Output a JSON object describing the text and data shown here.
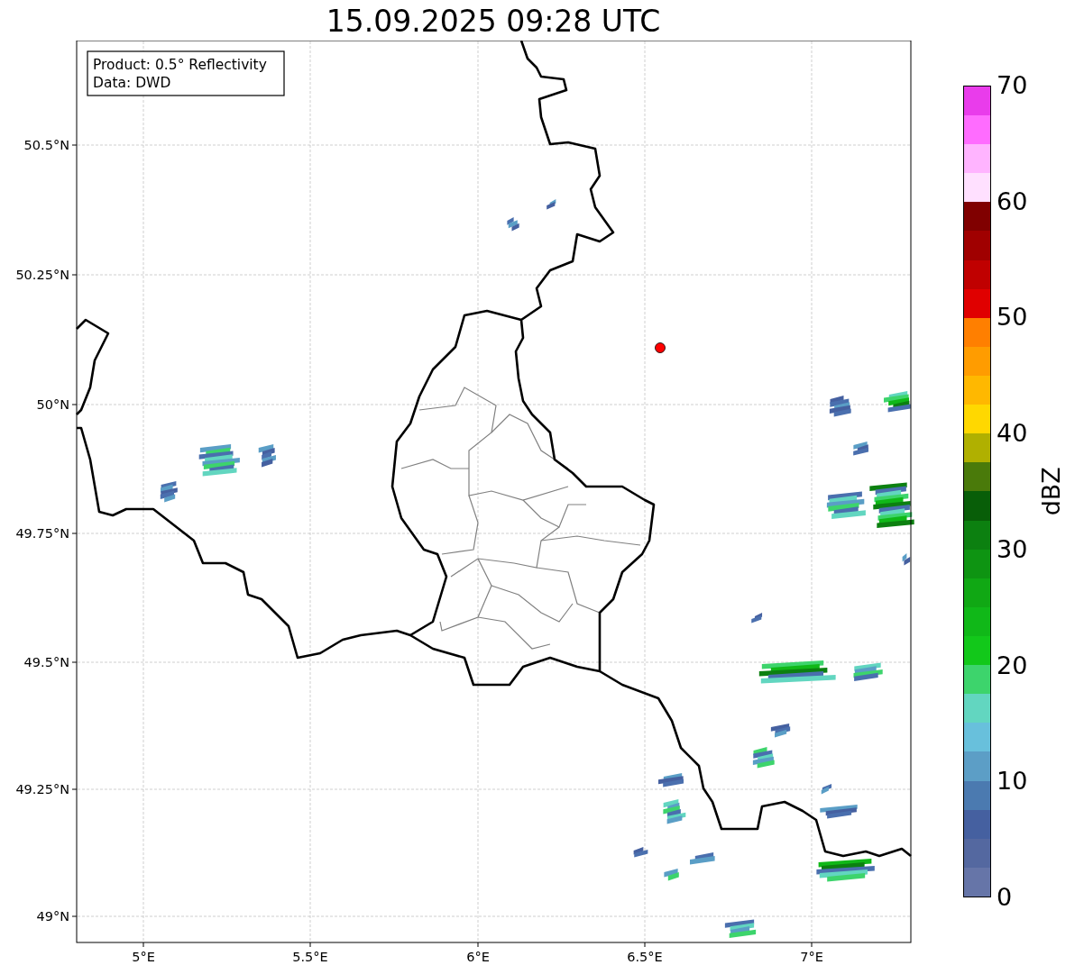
{
  "title": "15.09.2025 09:28 UTC",
  "info_box": [
    "Product: 0.5° Reflectivity",
    "Data: DWD"
  ],
  "map": {
    "x_ticks": [
      "5°E",
      "5.5°E",
      "6°E",
      "6.5°E",
      "7°E"
    ],
    "y_ticks": [
      "50.5°N",
      "50.25°N",
      "50°N",
      "49.75°N",
      "49.5°N",
      "49.25°N",
      "49°N"
    ]
  },
  "colorbar": {
    "label": "dBZ",
    "ticks": [
      "70",
      "60",
      "50",
      "40",
      "30",
      "20",
      "10",
      "0"
    ],
    "bins": [
      {
        "color": "#6675a8"
      },
      {
        "color": "#5468a0"
      },
      {
        "color": "#4560a0"
      },
      {
        "color": "#4b7ab0"
      },
      {
        "color": "#5c9ec6"
      },
      {
        "color": "#68c0dc"
      },
      {
        "color": "#62d6c0"
      },
      {
        "color": "#3dd46c"
      },
      {
        "color": "#12c81a"
      },
      {
        "color": "#10b818"
      },
      {
        "color": "#10a814"
      },
      {
        "color": "#0e9412"
      },
      {
        "color": "#0c8010"
      },
      {
        "color": "#085e08"
      },
      {
        "color": "#4a7a0a"
      },
      {
        "color": "#b0b000"
      },
      {
        "color": "#ffd800"
      },
      {
        "color": "#ffb800"
      },
      {
        "color": "#ff9c00"
      },
      {
        "color": "#ff7f00"
      },
      {
        "color": "#e00000"
      },
      {
        "color": "#c00000"
      },
      {
        "color": "#a00000"
      },
      {
        "color": "#800000"
      },
      {
        "color": "#ffe0ff"
      },
      {
        "color": "#ffb4ff"
      },
      {
        "color": "#ff6cff"
      },
      {
        "color": "#e93ceb"
      }
    ]
  }
}
